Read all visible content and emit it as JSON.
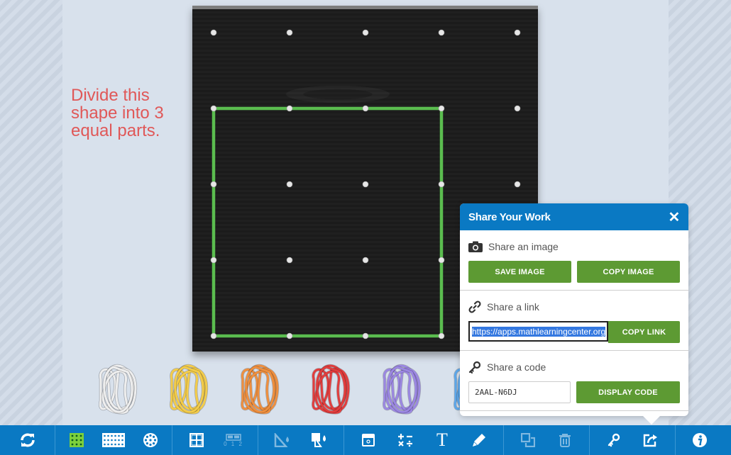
{
  "prompt": "Divide this shape into 3 equal parts.",
  "geoboard": {
    "pegs_per_side": 5,
    "band_color": "#5bbd4f",
    "band_shape_pegs": [
      [
        0,
        1
      ],
      [
        3,
        1
      ],
      [
        3,
        4
      ],
      [
        0,
        4
      ]
    ]
  },
  "rubber_bands": [
    {
      "name": "white",
      "color": "#eeeeee"
    },
    {
      "name": "yellow",
      "color": "#f3cc4a"
    },
    {
      "name": "orange",
      "color": "#ef8f3e"
    },
    {
      "name": "red",
      "color": "#e23d3d"
    },
    {
      "name": "purple",
      "color": "#9b87e2"
    },
    {
      "name": "blue",
      "color": "#5da8ec"
    }
  ],
  "share_panel": {
    "title": "Share Your Work",
    "close_label": "✕",
    "image_section": {
      "title": "Share an image",
      "save_label": "SAVE IMAGE",
      "copy_label": "COPY IMAGE"
    },
    "link_section": {
      "title": "Share a link",
      "url": "https://apps.mathlearningcenter.org",
      "copy_label": "COPY LINK"
    },
    "code_section": {
      "title": "Share a code",
      "code": "2AAL-N6DJ",
      "display_label": "DISPLAY CODE"
    }
  },
  "toolbar": {
    "groups": [
      [
        "reset-icon"
      ],
      [
        "grid-5x5-icon",
        "grid-large-icon",
        "circle-geoboard-icon"
      ],
      [
        "grid-lines-icon",
        "number-line-icon"
      ],
      [
        "angle-measure-icon",
        "fill-shape-icon"
      ],
      [
        "cover-icon",
        "math-symbols-icon",
        "text-icon",
        "pencil-icon"
      ],
      [
        "duplicate-icon",
        "trash-icon"
      ],
      [
        "key-icon",
        "share-icon"
      ],
      [
        "info-icon"
      ]
    ],
    "text_label": "T",
    "number_line_label": "0 1 2",
    "active_tool": "grid-5x5-icon",
    "active_color": "#7cd03c"
  }
}
